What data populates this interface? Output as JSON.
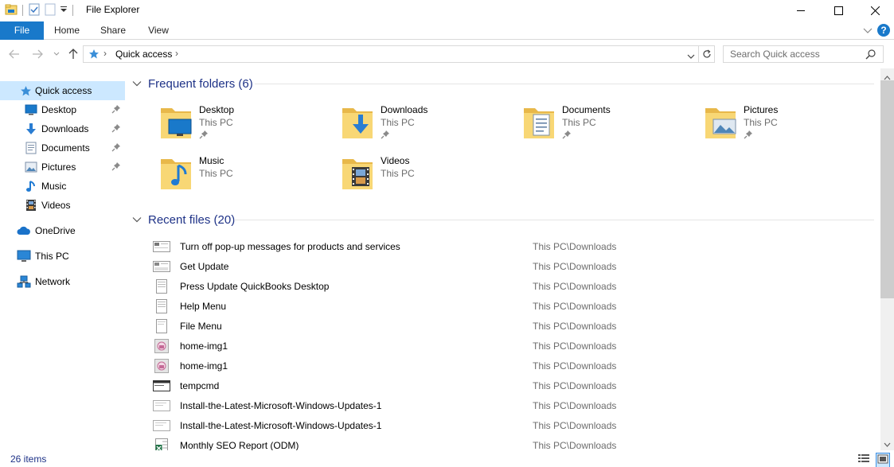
{
  "window": {
    "title": "File Explorer"
  },
  "ribbon": {
    "tabs": [
      "File",
      "Home",
      "Share",
      "View"
    ],
    "help_label": "?"
  },
  "address": {
    "location": "Quick access",
    "separator": "›"
  },
  "search": {
    "placeholder": "Search Quick access"
  },
  "sidebar": {
    "items": [
      {
        "label": "Quick access",
        "icon": "star-icon",
        "pinned": false,
        "active": true
      },
      {
        "label": "Desktop",
        "icon": "desktop-icon",
        "pinned": true
      },
      {
        "label": "Downloads",
        "icon": "download-arrow-icon",
        "pinned": true
      },
      {
        "label": "Documents",
        "icon": "documents-icon",
        "pinned": true
      },
      {
        "label": "Pictures",
        "icon": "pictures-icon",
        "pinned": true
      },
      {
        "label": "Music",
        "icon": "music-note-icon",
        "pinned": false
      },
      {
        "label": "Videos",
        "icon": "film-icon",
        "pinned": false
      },
      {
        "label": "OneDrive",
        "icon": "cloud-icon",
        "pinned": false
      },
      {
        "label": "This PC",
        "icon": "computer-icon",
        "pinned": false
      },
      {
        "label": "Network",
        "icon": "network-icon",
        "pinned": false
      }
    ]
  },
  "frequent": {
    "header": "Frequent folders (6)",
    "folders": [
      {
        "name": "Desktop",
        "location": "This PC",
        "pinned": true,
        "icon": "desktop-folder-icon"
      },
      {
        "name": "Downloads",
        "location": "This PC",
        "pinned": true,
        "icon": "downloads-folder-icon"
      },
      {
        "name": "Documents",
        "location": "This PC",
        "pinned": true,
        "icon": "documents-folder-icon"
      },
      {
        "name": "Pictures",
        "location": "This PC",
        "pinned": true,
        "icon": "pictures-folder-icon"
      },
      {
        "name": "Music",
        "location": "This PC",
        "pinned": false,
        "icon": "music-folder-icon"
      },
      {
        "name": "Videos",
        "location": "This PC",
        "pinned": false,
        "icon": "videos-folder-icon"
      }
    ]
  },
  "recent": {
    "header": "Recent files (20)",
    "files": [
      {
        "name": "Turn off pop-up messages for products and services",
        "path": "This PC\\Downloads",
        "icon": "image-file-icon"
      },
      {
        "name": "Get Update",
        "path": "This PC\\Downloads",
        "icon": "image-file-icon"
      },
      {
        "name": "Press Update QuickBooks Desktop",
        "path": "This PC\\Downloads",
        "icon": "document-file-icon"
      },
      {
        "name": "Help Menu",
        "path": "This PC\\Downloads",
        "icon": "document-file-icon"
      },
      {
        "name": "File Menu",
        "path": "This PC\\Downloads",
        "icon": "document-file-icon"
      },
      {
        "name": "home-img1",
        "path": "This PC\\Downloads",
        "icon": "photo-file-icon"
      },
      {
        "name": "home-img1",
        "path": "This PC\\Downloads",
        "icon": "photo-file-icon"
      },
      {
        "name": "tempcmd",
        "path": "This PC\\Downloads",
        "icon": "screenshot-file-icon"
      },
      {
        "name": "Install-the-Latest-Microsoft-Windows-Updates-1",
        "path": "This PC\\Downloads",
        "icon": "image-file-icon"
      },
      {
        "name": "Install-the-Latest-Microsoft-Windows-Updates-1",
        "path": "This PC\\Downloads",
        "icon": "image-file-icon"
      },
      {
        "name": "Monthly SEO Report (ODM)",
        "path": "This PC\\Downloads",
        "icon": "spreadsheet-file-icon"
      }
    ]
  },
  "status": {
    "item_count": "26 items"
  },
  "colors": {
    "accent": "#1979ca",
    "selection": "#cce8ff",
    "header_text": "#1e3287",
    "muted_text": "#6d6d6d",
    "folder_yellow": "#f8d775"
  }
}
